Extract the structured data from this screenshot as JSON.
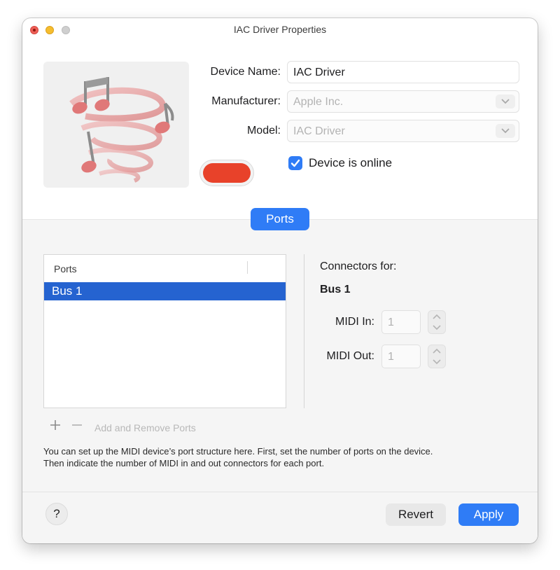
{
  "window": {
    "title": "IAC Driver Properties"
  },
  "device": {
    "name_label": "Device Name:",
    "name_value": "IAC Driver",
    "manufacturer_label": "Manufacturer:",
    "manufacturer_value": "Apple Inc.",
    "model_label": "Model:",
    "model_value": "IAC Driver",
    "online_label": "Device is online",
    "online_checked": true,
    "color": "#e8422a",
    "icon": "midi-notes-swirl-icon"
  },
  "tabs": {
    "ports_label": "Ports"
  },
  "ports_table": {
    "header": "Ports",
    "rows": [
      "Bus 1"
    ],
    "selected_index": 0
  },
  "connectors": {
    "title": "Connectors for:",
    "bus_name": "Bus 1",
    "midi_in_label": "MIDI In:",
    "midi_in_value": "1",
    "midi_out_label": "MIDI Out:",
    "midi_out_value": "1"
  },
  "port_controls": {
    "add_icon": "plus-icon",
    "remove_icon": "minus-icon",
    "label": "Add and Remove Ports"
  },
  "help_text": {
    "line1": "You can set up the MIDI device’s port structure here. First, set the number of ports on the device.",
    "line2": "Then indicate the number of MIDI in and out connectors for each port."
  },
  "footer": {
    "help_label": "?",
    "revert_label": "Revert",
    "apply_label": "Apply"
  },
  "colors": {
    "accent": "#2f7cf6",
    "selection": "#2563d0",
    "close_light": "#ee5f57",
    "minimize_light": "#f5bd2e"
  }
}
